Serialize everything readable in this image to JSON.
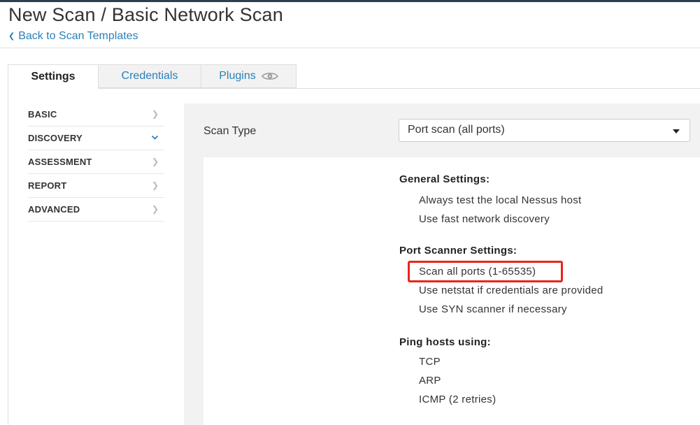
{
  "header": {
    "title": "New Scan / Basic Network Scan",
    "back_link": "Back to Scan Templates"
  },
  "tabs": [
    {
      "label": "Settings",
      "active": true
    },
    {
      "label": "Credentials",
      "active": false
    },
    {
      "label": "Plugins",
      "active": false,
      "icon": "eye-icon"
    }
  ],
  "sidebar": {
    "items": [
      {
        "label": "BASIC",
        "icon": "chevron-right-icon"
      },
      {
        "label": "DISCOVERY",
        "icon": "chevron-down-icon",
        "active": true
      },
      {
        "label": "ASSESSMENT",
        "icon": "chevron-right-icon"
      },
      {
        "label": "REPORT",
        "icon": "chevron-right-icon"
      },
      {
        "label": "ADVANCED",
        "icon": "chevron-right-icon"
      }
    ]
  },
  "main": {
    "scan_type_label": "Scan Type",
    "scan_type_value": "Port scan (all ports)",
    "sections": [
      {
        "title": "General Settings:",
        "items": [
          "Always test the local Nessus host",
          "Use fast network discovery"
        ]
      },
      {
        "title": "Port Scanner Settings:",
        "items": [
          "Scan all ports (1-65535)",
          "Use netstat if credentials are provided",
          "Use SYN scanner if necessary"
        ]
      },
      {
        "title": "Ping hosts using:",
        "items": [
          "TCP",
          "ARP",
          "ICMP (2 retries)"
        ]
      }
    ]
  },
  "colors": {
    "link": "#2a80b9",
    "highlight_border": "#e8251d",
    "content_bg": "#f2f2f2"
  }
}
